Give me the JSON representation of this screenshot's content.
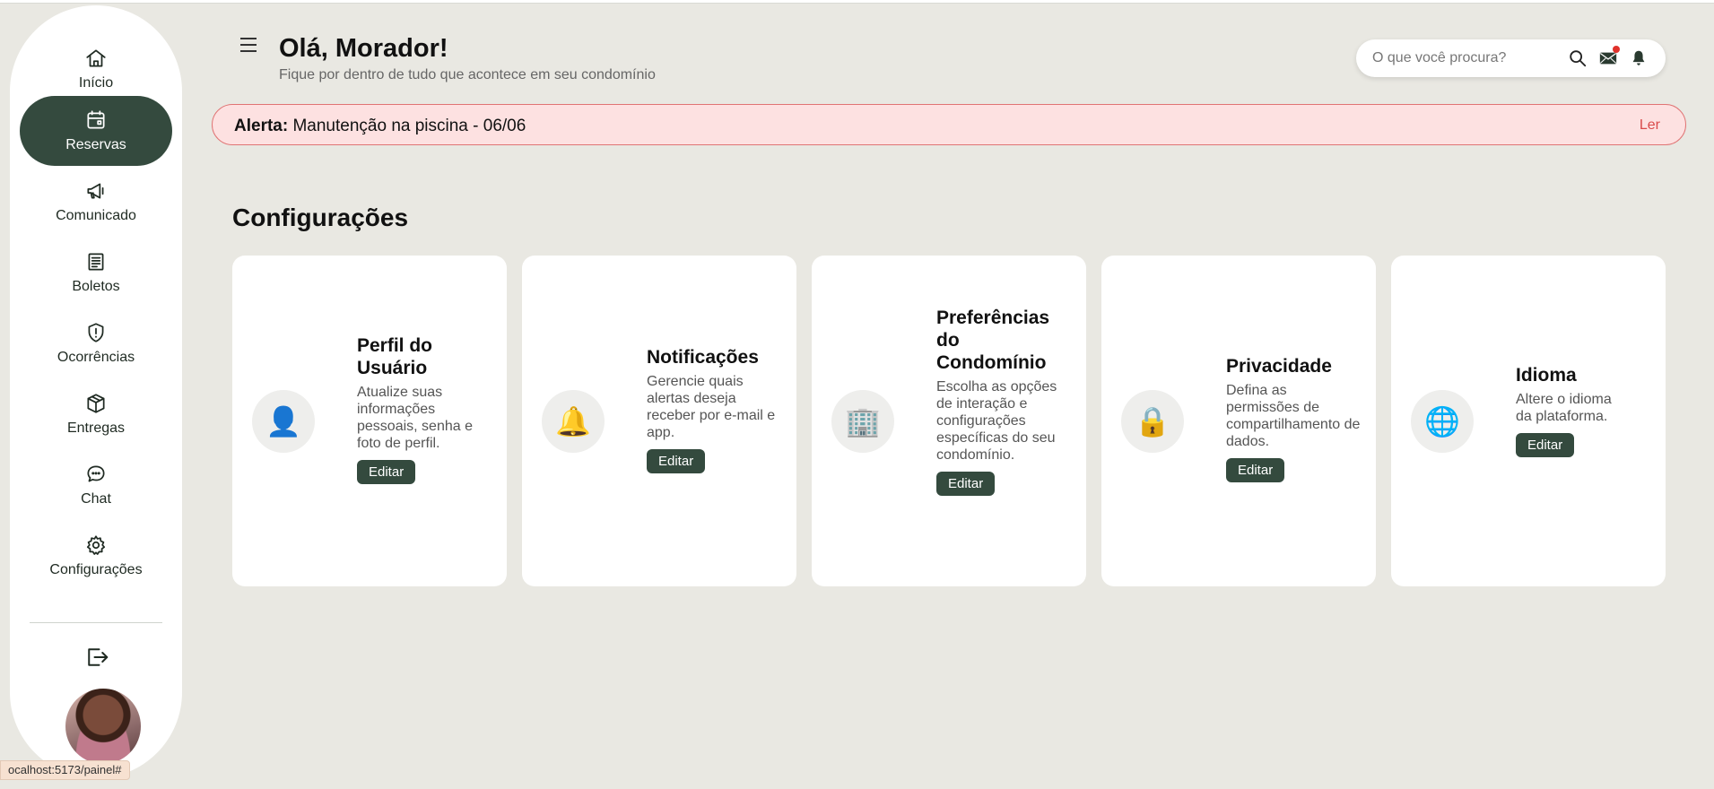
{
  "sidebar": {
    "items": [
      {
        "label": "Início",
        "icon": "home-icon"
      },
      {
        "label": "Reservas",
        "icon": "calendar-icon",
        "active": true
      },
      {
        "label": "Comunicado",
        "icon": "megaphone-icon"
      },
      {
        "label": "Boletos",
        "icon": "receipt-icon"
      },
      {
        "label": "Ocorrências",
        "icon": "shield-alert-icon"
      },
      {
        "label": "Entregas",
        "icon": "package-icon"
      },
      {
        "label": "Chat",
        "icon": "chat-bubble-icon"
      },
      {
        "label": "Configurações",
        "icon": "gear-icon"
      }
    ],
    "logout_icon": "logout-icon",
    "url_hint": "ocalhost:5173/painel#"
  },
  "header": {
    "title": "Olá, Morador!",
    "subtitle": "Fique por dentro de tudo que acontece em seu condomínio",
    "search_placeholder": "O que você procura?"
  },
  "alert": {
    "label": "Alerta:",
    "message": "Manutenção na piscina - 06/06",
    "action": "Ler"
  },
  "settings": {
    "title": "Configurações",
    "cards": [
      {
        "title": "Perfil do Usuário",
        "desc": "Atualize suas informações pessoais, senha e foto de perfil.",
        "button": "Editar",
        "icon": "👤"
      },
      {
        "title": "Notificações",
        "desc": "Gerencie quais alertas deseja receber por e-mail e app.",
        "button": "Editar",
        "icon": "🔔"
      },
      {
        "title": "Preferências do Condomínio",
        "desc": "Escolha as opções de interação e configurações específicas do seu condomínio.",
        "button": "Editar",
        "icon": "🏢"
      },
      {
        "title": "Privacidade",
        "desc": "Defina as permissões de compartilhamento de dados.",
        "button": "Editar",
        "icon": "🔒"
      },
      {
        "title": "Idioma",
        "desc": "Altere o idioma da plataforma.",
        "button": "Editar",
        "icon": "🌐"
      }
    ]
  },
  "colors": {
    "accent": "#344a3e",
    "background": "#e9e8e2",
    "alert_bg": "#fde1e1",
    "alert_border": "#e07474"
  }
}
